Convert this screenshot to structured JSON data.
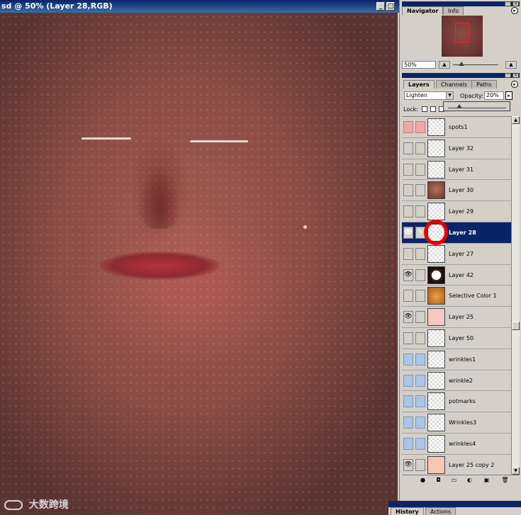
{
  "document": {
    "title": "sd @ 50% (Layer 28,RGB)",
    "buttons": [
      "_",
      "□",
      "×"
    ]
  },
  "watermark": {
    "text": "大数跨境"
  },
  "navigator": {
    "tabs": [
      "Navigator",
      "Info"
    ],
    "zoom": "50%"
  },
  "layers_panel": {
    "tabs": [
      "Layers",
      "Channels",
      "Paths"
    ],
    "blend_mode": "Lighten",
    "opacity_label": "Opacity:",
    "opacity": "20%",
    "lock_label": "Lock:",
    "layers": [
      {
        "name": "spots1",
        "visible": false,
        "brush": false,
        "color": "red"
      },
      {
        "name": "Layer 32",
        "visible": false,
        "brush": false,
        "color": "none"
      },
      {
        "name": "Layer 31",
        "visible": false,
        "brush": false,
        "color": "none"
      },
      {
        "name": "Layer 30",
        "visible": false,
        "brush": false,
        "color": "none"
      },
      {
        "name": "Layer 29",
        "visible": false,
        "brush": false,
        "color": "none"
      },
      {
        "name": "Layer 28",
        "visible": true,
        "brush": true,
        "color": "none",
        "selected": true
      },
      {
        "name": "Layer 27",
        "visible": false,
        "brush": false,
        "color": "none"
      },
      {
        "name": "Layer 42",
        "visible": true,
        "brush": false,
        "color": "none"
      },
      {
        "name": "Selective Color 1",
        "visible": false,
        "brush": false,
        "color": "none"
      },
      {
        "name": "Layer 25",
        "visible": true,
        "brush": false,
        "color": "none"
      },
      {
        "name": "Layer 50",
        "visible": false,
        "brush": false,
        "color": "none"
      },
      {
        "name": "wrinkles1",
        "visible": false,
        "brush": false,
        "color": "blue"
      },
      {
        "name": "wrinkle2",
        "visible": false,
        "brush": false,
        "color": "blue"
      },
      {
        "name": "potmarks",
        "visible": false,
        "brush": false,
        "color": "blue"
      },
      {
        "name": "Wrinkles3",
        "visible": false,
        "brush": false,
        "color": "blue"
      },
      {
        "name": "wrinkles4",
        "visible": false,
        "brush": false,
        "color": "blue"
      },
      {
        "name": "Layer 25 copy 2",
        "visible": true,
        "brush": false,
        "color": "none"
      }
    ]
  },
  "history_panel": {
    "tabs": [
      "History",
      "Actions"
    ]
  },
  "icons": {
    "eye": "👁",
    "brush": "✎"
  }
}
